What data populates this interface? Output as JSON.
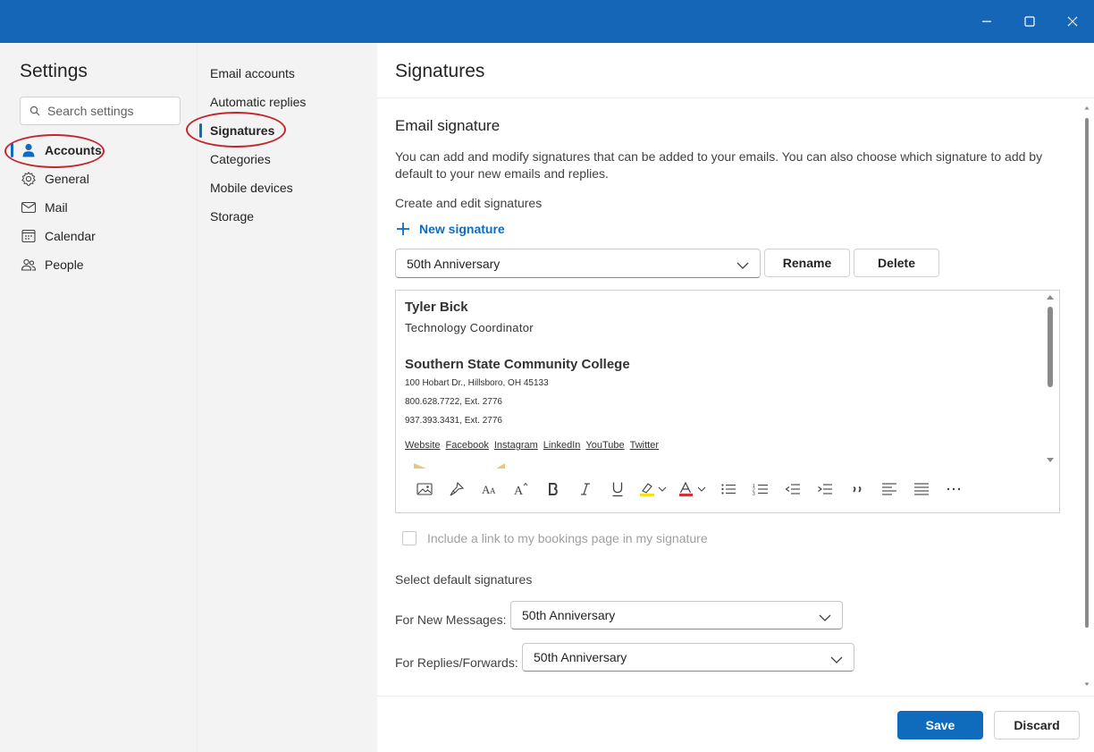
{
  "window": {
    "colors": {
      "titlebar": "#1566b7",
      "accent": "#0f6cbd",
      "annotation": "#c3262f"
    },
    "controls": [
      "minimize-icon",
      "maximize-icon",
      "close-icon"
    ]
  },
  "settings": {
    "title": "Settings",
    "search_placeholder": "Search settings",
    "nav": [
      {
        "label": "Accounts",
        "icon": "person-icon",
        "active": true
      },
      {
        "label": "General",
        "icon": "gear-icon"
      },
      {
        "label": "Mail",
        "icon": "mail-icon"
      },
      {
        "label": "Calendar",
        "icon": "calendar-icon"
      },
      {
        "label": "People",
        "icon": "people-icon"
      }
    ]
  },
  "accounts_menu": {
    "items": [
      "Email accounts",
      "Automatic replies",
      "Signatures",
      "Categories",
      "Mobile devices",
      "Storage"
    ],
    "active": "Signatures"
  },
  "signatures": {
    "title": "Signatures",
    "section_title": "Email signature",
    "description": "You can add and modify signatures that can be added to your emails. You can also choose which signature to add by default to your new emails and replies.",
    "create_label": "Create and edit signatures",
    "new_signature": "New signature",
    "selected_signature": "50th Anniversary",
    "rename": "Rename",
    "delete": "Delete",
    "editor": {
      "name": "Tyler Bick",
      "role": "Technology Coordinator",
      "college": "Southern State Community College",
      "address": "100 Hobart Dr., Hillsboro, OH  45133",
      "phone1": "800.628.7722, Ext. 2776",
      "phone2": "937.393.3431, Ext. 2776",
      "links": [
        "Website",
        "Facebook",
        "Instagram",
        "LinkedIn",
        "YouTube",
        "Twitter"
      ],
      "toolbar": [
        "image-icon",
        "format-painter-icon",
        "font-size-icon",
        "font-grow-icon",
        "bold-icon",
        "italic-icon",
        "underline-icon",
        "highlight-icon",
        "font-color-icon",
        "bullets-icon",
        "numbering-icon",
        "outdent-icon",
        "indent-icon",
        "quote-icon",
        "align-left-icon",
        "align-justify-icon",
        "more-icon"
      ]
    },
    "bookings_checkbox": "Include a link to my bookings page in my signature",
    "defaults_label": "Select default signatures",
    "new_messages_label": "For New Messages:",
    "new_messages_value": "50th Anniversary",
    "replies_label": "For Replies/Forwards:",
    "replies_value": "50th Anniversary"
  },
  "footer": {
    "save": "Save",
    "discard": "Discard"
  }
}
